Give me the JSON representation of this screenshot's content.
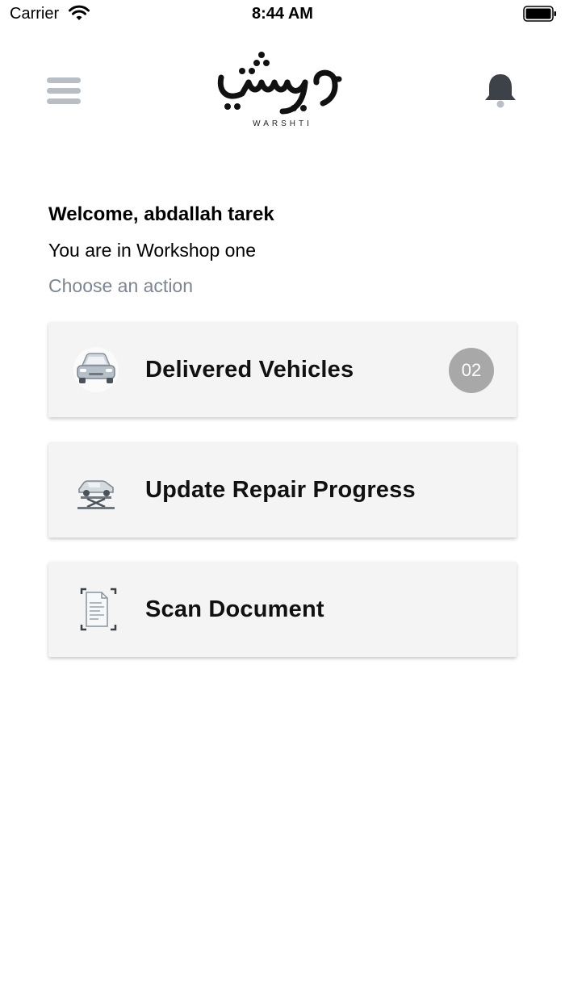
{
  "status_bar": {
    "carrier": "Carrier",
    "time": "8:44 AM"
  },
  "header": {
    "logo_arabic": "ورشتي",
    "logo_latin": "WARSHTI",
    "menu_icon": "hamburger-menu-icon",
    "notification_icon": "bell-icon"
  },
  "welcome": {
    "greeting": "Welcome, abdallah tarek",
    "location": "You are in Workshop one",
    "prompt": "Choose an action"
  },
  "actions": [
    {
      "label": "Delivered Vehicles",
      "icon": "car-front-icon",
      "badge": "02"
    },
    {
      "label": "Update Repair Progress",
      "icon": "car-lift-icon"
    },
    {
      "label": "Scan Document",
      "icon": "scan-document-icon"
    }
  ],
  "colors": {
    "menu_icon": "#b9bec4",
    "bell_icon": "#3d4148",
    "prompt_text": "#7c8590",
    "card_bg": "#f4f4f4",
    "badge_bg": "#a8a8a8"
  }
}
